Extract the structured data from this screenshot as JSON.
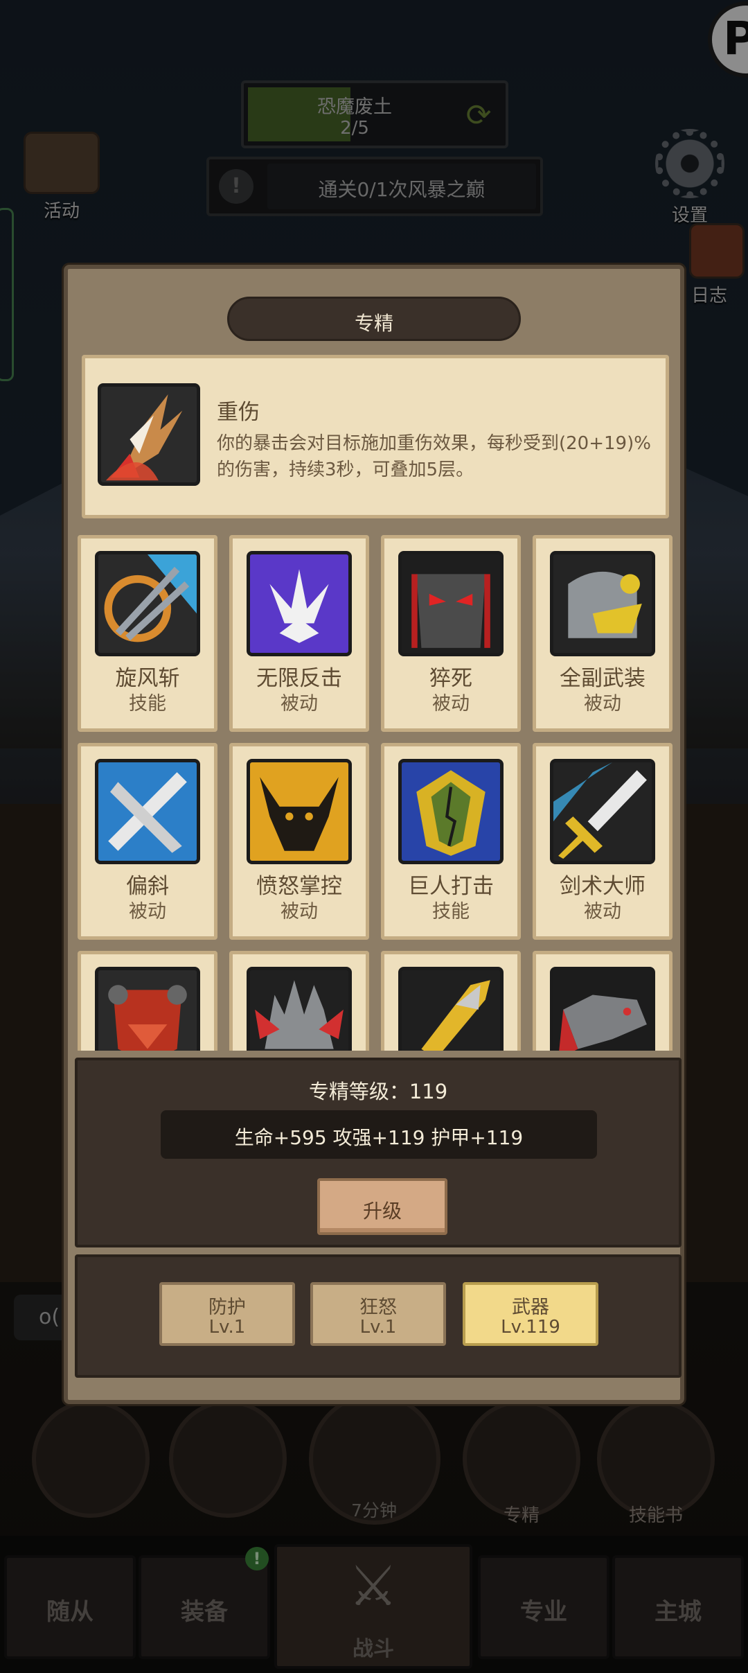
{
  "zone": {
    "name": "恐魔废土",
    "progress": "2/5",
    "progress_fraction": 0.4
  },
  "quest": {
    "text": "通关0/1次风暴之巅"
  },
  "side": {
    "activity_label": "活动",
    "settings_label": "设置",
    "log_label": "日志"
  },
  "modal": {
    "title": "专精",
    "selected": {
      "name": "重伤",
      "description": "你的暴击会对目标施加重伤效果，每秒受到(20+19)%的伤害，持续3秒，可叠加5层。",
      "icon": "claw-strike-icon"
    },
    "skills": [
      {
        "name": "旋风斩",
        "type": "技能",
        "icon": "whirlwind-icon"
      },
      {
        "name": "无限反击",
        "type": "被动",
        "icon": "counter-icon"
      },
      {
        "name": "猝死",
        "type": "被动",
        "icon": "dark-helm-icon"
      },
      {
        "name": "全副武装",
        "type": "被动",
        "icon": "armor-helm-icon"
      },
      {
        "name": "偏斜",
        "type": "被动",
        "icon": "crossed-blades-icon"
      },
      {
        "name": "愤怒掌控",
        "type": "被动",
        "icon": "bull-fury-icon"
      },
      {
        "name": "巨人打击",
        "type": "技能",
        "icon": "giant-shield-icon"
      },
      {
        "name": "剑术大师",
        "type": "被动",
        "icon": "sword-master-icon"
      },
      {
        "name": "",
        "type": "",
        "icon": "dragon-shield-icon"
      },
      {
        "name": "",
        "type": "",
        "icon": "spiked-helm-icon"
      },
      {
        "name": "",
        "type": "",
        "icon": "golden-spear-icon"
      },
      {
        "name": "",
        "type": "",
        "icon": "dragon-head-icon"
      }
    ],
    "level_label": "专精等级：119",
    "stats": "生命+595  攻强+119  护甲+119",
    "upgrade_label": "升级",
    "trees": [
      {
        "name": "防护",
        "level": "Lv.1",
        "active": false
      },
      {
        "name": "狂怒",
        "level": "Lv.1",
        "active": false
      },
      {
        "name": "武器",
        "level": "Lv.119",
        "active": true
      }
    ]
  },
  "quickbar": {
    "spec_label": "专精",
    "skillbook_label": "技能书",
    "timer": "7分钟"
  },
  "left_chip": "o(",
  "nav": {
    "followers": "随从",
    "equipment": "装备",
    "equipment_badge": "!",
    "battle": "战斗",
    "profession": "专业",
    "main_city": "主城"
  },
  "colors": {
    "panel_bg": "#8d7d66",
    "card_bg": "#eedfbd",
    "active_tab": "#f2d98a",
    "dark_panel": "#3a3029"
  }
}
